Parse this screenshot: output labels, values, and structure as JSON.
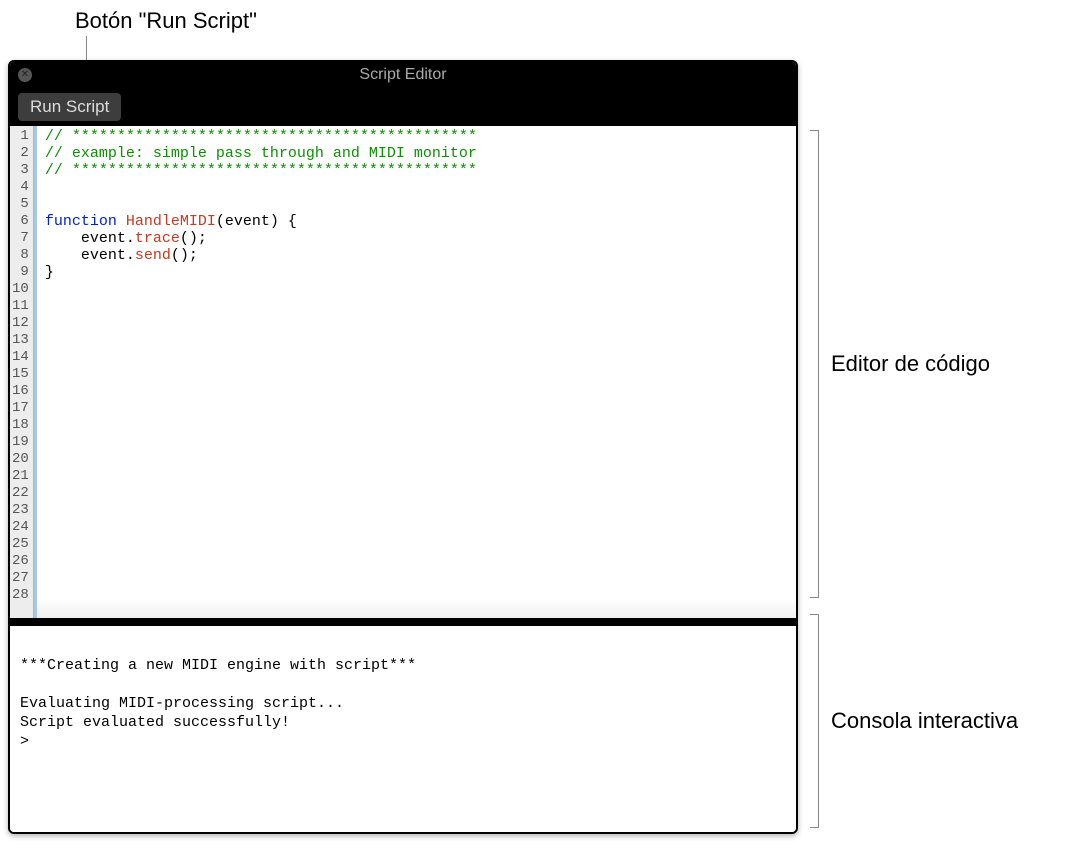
{
  "callouts": {
    "run_button": "Botón \"Run Script\"",
    "editor": "Editor de código",
    "console": "Consola interactiva"
  },
  "window": {
    "title": "Script Editor",
    "run_button_label": "Run Script"
  },
  "editor": {
    "total_lines": 28,
    "lines": [
      {
        "n": 1,
        "tokens": [
          {
            "cls": "tok-comment",
            "t": "// *********************************************"
          }
        ]
      },
      {
        "n": 2,
        "tokens": [
          {
            "cls": "tok-comment",
            "t": "// example: simple pass through and MIDI monitor"
          }
        ]
      },
      {
        "n": 3,
        "tokens": [
          {
            "cls": "tok-comment",
            "t": "// *********************************************"
          }
        ]
      },
      {
        "n": 4,
        "tokens": []
      },
      {
        "n": 5,
        "tokens": []
      },
      {
        "n": 6,
        "tokens": [
          {
            "cls": "tok-keyword",
            "t": "function"
          },
          {
            "cls": "",
            "t": " "
          },
          {
            "cls": "tok-ident",
            "t": "HandleMIDI"
          },
          {
            "cls": "",
            "t": "(event) {"
          }
        ]
      },
      {
        "n": 7,
        "tokens": [
          {
            "cls": "",
            "t": "    event."
          },
          {
            "cls": "tok-ident",
            "t": "trace"
          },
          {
            "cls": "",
            "t": "();"
          }
        ]
      },
      {
        "n": 8,
        "tokens": [
          {
            "cls": "",
            "t": "    event."
          },
          {
            "cls": "tok-ident",
            "t": "send"
          },
          {
            "cls": "",
            "t": "();"
          }
        ]
      },
      {
        "n": 9,
        "tokens": [
          {
            "cls": "",
            "t": "}"
          }
        ]
      }
    ]
  },
  "console": {
    "lines": [
      "***Creating a new MIDI engine with script***",
      "",
      "Evaluating MIDI-processing script...",
      "Script evaluated successfully!",
      ">"
    ]
  }
}
